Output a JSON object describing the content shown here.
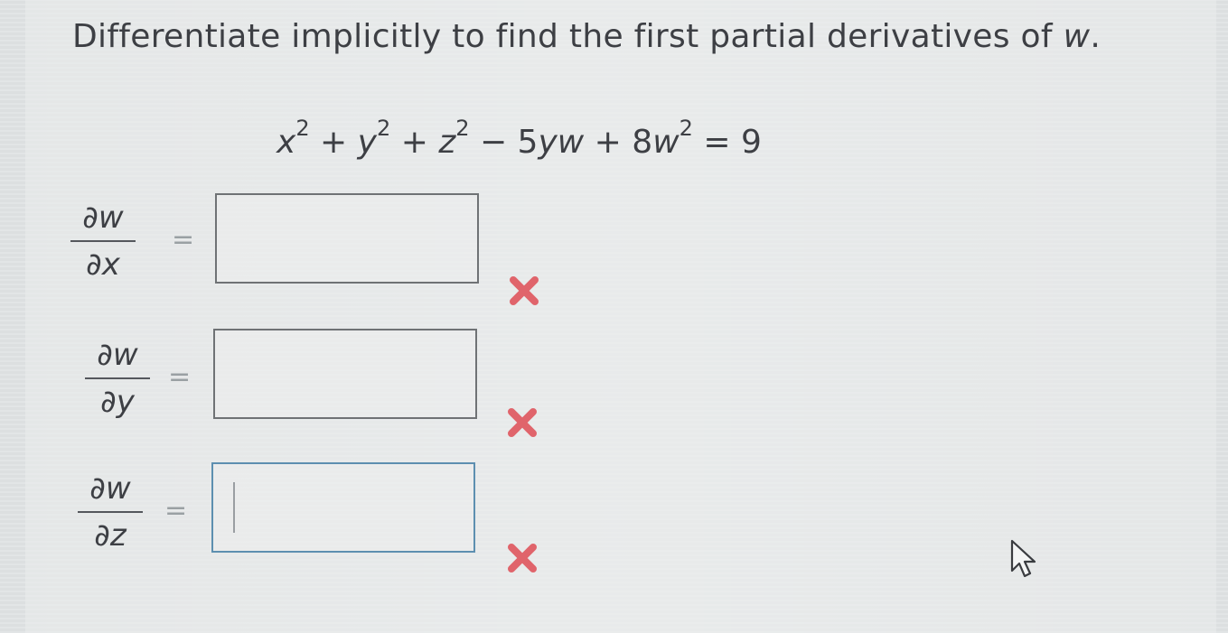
{
  "question": {
    "prefix": "Differentiate implicitly to find the first partial derivatives of",
    "variable": "w",
    "suffix": "."
  },
  "equation": {
    "t1_base": "x",
    "t1_exp": "2",
    "op1": " + ",
    "t2_base": "y",
    "t2_exp": "2",
    "op2": " + ",
    "t3_base": "z",
    "t3_exp": "2",
    "op3": " − 5",
    "t4": "yw",
    "op4": " + 8",
    "t5_base": "w",
    "t5_exp": "2",
    "rhs": " = 9"
  },
  "rows": [
    {
      "num": "∂w",
      "den": "∂x",
      "equals": "=",
      "value": "",
      "status": "incorrect"
    },
    {
      "num": "∂w",
      "den": "∂y",
      "equals": "=",
      "value": "",
      "status": "incorrect"
    },
    {
      "num": "∂w",
      "den": "∂z",
      "equals": "=",
      "value": "",
      "status": "incorrect"
    }
  ],
  "colors": {
    "incorrect_mark": "#e0646b",
    "active_border": "#5d8fb0"
  },
  "icons": {
    "incorrect": "x-mark-icon",
    "pointer": "mouse-pointer-icon"
  }
}
